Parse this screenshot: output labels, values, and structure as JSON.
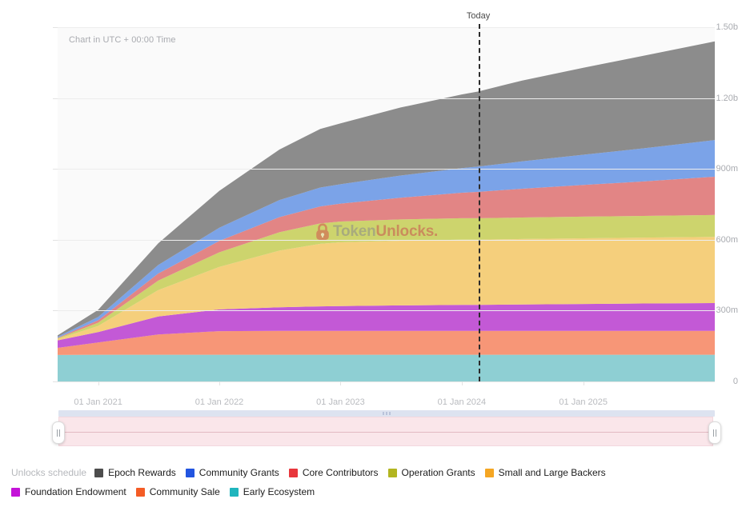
{
  "chart_data": {
    "type": "area",
    "stacked": true,
    "title": "",
    "subtitle": "Chart in UTC + 00:00 Time",
    "xlabel": "",
    "ylabel": "",
    "ylim": [
      0,
      1500000000
    ],
    "grid": true,
    "legend_position": "bottom",
    "legend_title": "Unlocks schedule",
    "y_ticks": [
      {
        "label": "1.50b",
        "value": 1500000000
      },
      {
        "label": "1.20b",
        "value": 1200000000
      },
      {
        "label": "900m",
        "value": 900000000
      },
      {
        "label": "600m",
        "value": 600000000
      },
      {
        "label": "300m",
        "value": 300000000
      },
      {
        "label": "0",
        "value": 0
      }
    ],
    "x_ticks": [
      {
        "label": "01 Jan 2021",
        "value": "2021-01-01"
      },
      {
        "label": "01 Jan 2022",
        "value": "2022-01-01"
      },
      {
        "label": "01 Jan 2023",
        "value": "2023-01-01"
      },
      {
        "label": "01 Jan 2024",
        "value": "2024-01-01"
      },
      {
        "label": "01 Jan 2025",
        "value": "2025-01-01"
      }
    ],
    "x_domain": [
      "2020-09-01",
      "2026-02-01"
    ],
    "annotations": [
      {
        "name": "today-marker",
        "label": "Today",
        "x": "2024-02-20",
        "style": "dashed-vertical"
      }
    ],
    "x": [
      "2020-09-01",
      "2021-01-01",
      "2021-07-01",
      "2022-01-01",
      "2022-07-01",
      "2022-11-01",
      "2023-01-01",
      "2023-07-01",
      "2024-01-01",
      "2024-02-20",
      "2024-07-01",
      "2025-01-01",
      "2025-07-01",
      "2026-02-01"
    ],
    "series": [
      {
        "name": "Early Ecosystem",
        "color": "#8ecfd3",
        "values": [
          112000000,
          113000000,
          113000000,
          113000000,
          113000000,
          113000000,
          113000000,
          113000000,
          113000000,
          113000000,
          113000000,
          113000000,
          113000000,
          113000000
        ]
      },
      {
        "name": "Community Sale",
        "color": "#f79677",
        "values": [
          30000000,
          52000000,
          86000000,
          100000000,
          101000000,
          101000000,
          101000000,
          101000000,
          101000000,
          101000000,
          101000000,
          101000000,
          101000000,
          101000000
        ]
      },
      {
        "name": "Foundation Endowment",
        "color": "#c359d6",
        "values": [
          32000000,
          44000000,
          76000000,
          92000000,
          100000000,
          104000000,
          105000000,
          108000000,
          110000000,
          110000000,
          112000000,
          114000000,
          116000000,
          118000000
        ]
      },
      {
        "name": "Small and Large Backers",
        "color": "#f5cf7c",
        "values": [
          6000000,
          26000000,
          112000000,
          180000000,
          240000000,
          265000000,
          270000000,
          274000000,
          276000000,
          276000000,
          277000000,
          278000000,
          279000000,
          280000000
        ]
      },
      {
        "name": "Operation Grants",
        "color": "#cdd46d",
        "values": [
          3000000,
          14000000,
          40000000,
          62000000,
          78000000,
          86000000,
          88000000,
          90000000,
          91000000,
          91000000,
          91000000,
          92000000,
          92000000,
          93000000
        ]
      },
      {
        "name": "Core Contributors",
        "color": "#e28585",
        "values": [
          2000000,
          10000000,
          30000000,
          48000000,
          64000000,
          72000000,
          76000000,
          92000000,
          108000000,
          112000000,
          122000000,
          134000000,
          146000000,
          162000000
        ]
      },
      {
        "name": "Community Grants",
        "color": "#7ba3e8",
        "values": [
          4000000,
          14000000,
          36000000,
          56000000,
          72000000,
          80000000,
          82000000,
          94000000,
          104000000,
          107000000,
          116000000,
          128000000,
          140000000,
          155000000
        ]
      },
      {
        "name": "Epoch Rewards",
        "color": "#8c8c8c",
        "values": [
          6000000,
          30000000,
          92000000,
          156000000,
          214000000,
          248000000,
          258000000,
          288000000,
          312000000,
          318000000,
          342000000,
          368000000,
          392000000,
          418000000
        ]
      }
    ]
  },
  "axis_note": "Chart in UTC + 00:00 Time",
  "today": {
    "label": "Today"
  },
  "watermark": {
    "lock_icon": "lock-icon",
    "token": "Token",
    "unlocks": "Unlocks."
  },
  "range_slider": {
    "name": "date-range-slider",
    "left_handle": "range-handle-left",
    "right_handle": "range-handle-right"
  },
  "legend": {
    "title": "Unlocks schedule",
    "items": [
      {
        "label": "Epoch Rewards",
        "color": "#4d4d4d"
      },
      {
        "label": "Community Grants",
        "color": "#2255e0"
      },
      {
        "label": "Core Contributors",
        "color": "#e8363c"
      },
      {
        "label": "Operation Grants",
        "color": "#b2b520"
      },
      {
        "label": "Small and Large Backers",
        "color": "#f5a623"
      },
      {
        "label": "Foundation Endowment",
        "color": "#c413d8"
      },
      {
        "label": "Community Sale",
        "color": "#f45c25"
      },
      {
        "label": "Early Ecosystem",
        "color": "#1fb5bd"
      }
    ]
  }
}
